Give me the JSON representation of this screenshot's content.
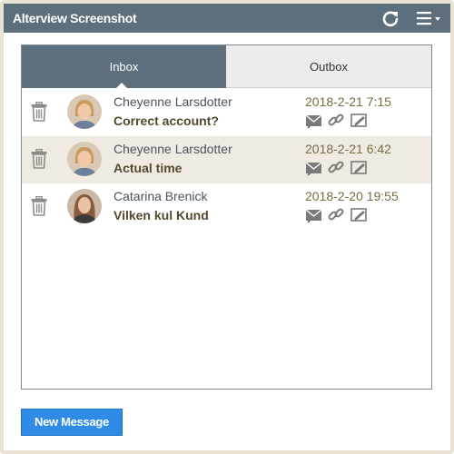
{
  "window": {
    "title": "Alterview Screenshot"
  },
  "icons": {
    "refresh": "refresh-icon",
    "menu": "hamburger-menu-icon"
  },
  "tabs": [
    {
      "label": "Inbox",
      "active": true
    },
    {
      "label": "Outbox",
      "active": false
    }
  ],
  "messages": [
    {
      "sender": "Cheyenne Larsdotter",
      "subject": "Correct account?",
      "date": "2018-2-21 7:15",
      "avatar": "woman-short-hair",
      "highlighted": false
    },
    {
      "sender": "Cheyenne Larsdotter",
      "subject": "Actual time",
      "date": "2018-2-21 6:42",
      "avatar": "woman-short-hair",
      "highlighted": true
    },
    {
      "sender": "Catarina Brenick",
      "subject": "Vilken kul Kund",
      "date": "2018-2-20 19:55",
      "avatar": "woman-long-hair",
      "highlighted": false
    }
  ],
  "actions": {
    "new_message": "New Message"
  },
  "colors": {
    "header": "#5d6f7d",
    "button": "#2f8ce6",
    "highlight_row": "#efebe2",
    "frame": "#e9e3d3"
  }
}
